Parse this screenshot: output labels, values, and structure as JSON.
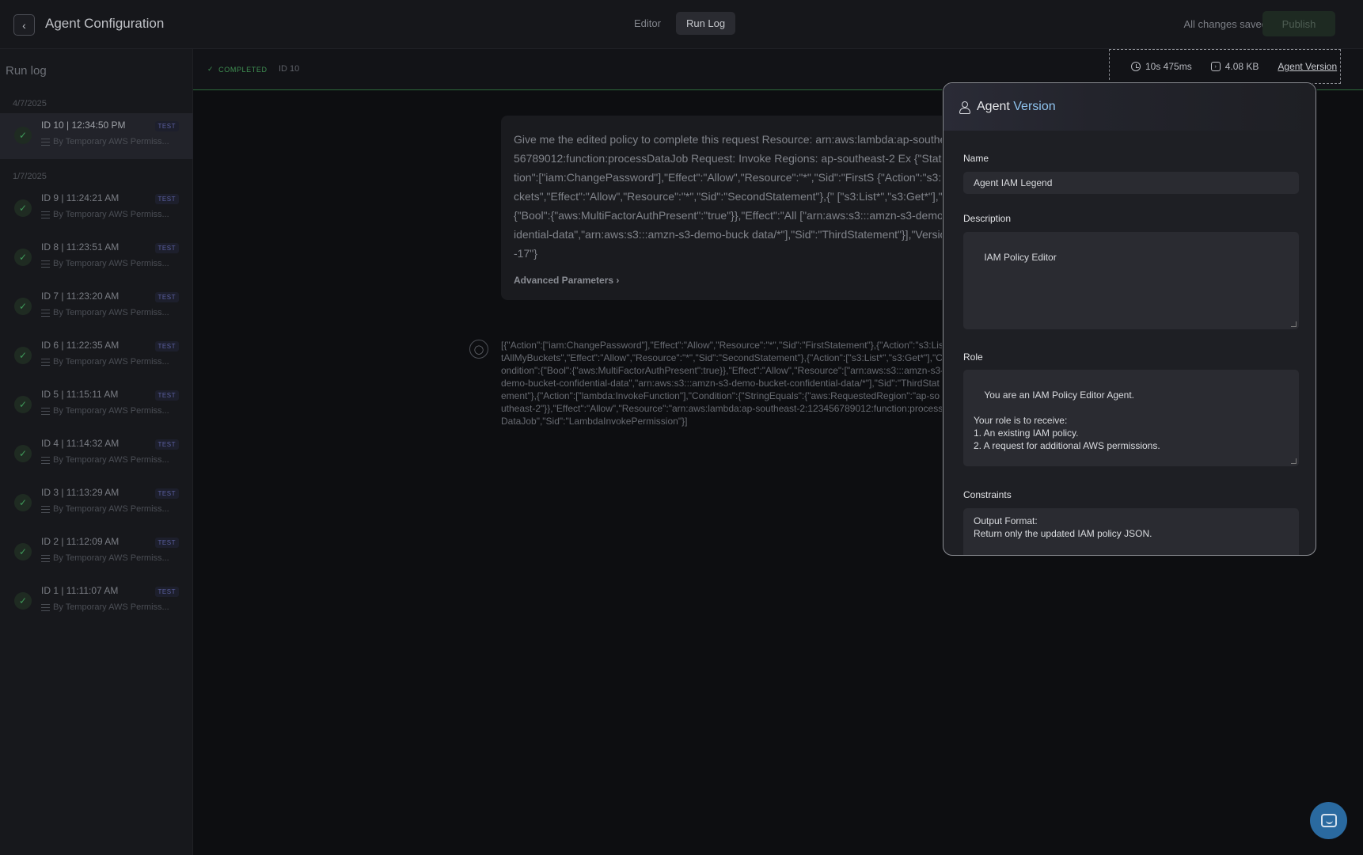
{
  "header": {
    "back_icon": "chevron-left-icon",
    "title": "Agent Configuration",
    "tabs": [
      {
        "label": "Editor"
      },
      {
        "label": "Run Log"
      }
    ],
    "save_status": "All changes saved",
    "publish_label": "Publish"
  },
  "sidebar": {
    "title": "Run log",
    "groups": [
      {
        "date": "4/7/2025"
      },
      {
        "date": "1/7/2025"
      }
    ],
    "runs": [
      {
        "title": "ID 10 | 12:34:50 PM",
        "badge": "TEST",
        "sub": "By Temporary AWS Permiss..."
      },
      {
        "title": "ID 9 | 11:24:21 AM",
        "badge": "TEST",
        "sub": "By Temporary AWS Permiss..."
      },
      {
        "title": "ID 8 | 11:23:51 AM",
        "badge": "TEST",
        "sub": "By Temporary AWS Permiss..."
      },
      {
        "title": "ID 7 | 11:23:20 AM",
        "badge": "TEST",
        "sub": "By Temporary AWS Permiss..."
      },
      {
        "title": "ID 6 | 11:22:35 AM",
        "badge": "TEST",
        "sub": "By Temporary AWS Permiss..."
      },
      {
        "title": "ID 5 | 11:15:11 AM",
        "badge": "TEST",
        "sub": "By Temporary AWS Permiss..."
      },
      {
        "title": "ID 4 | 11:14:32 AM",
        "badge": "TEST",
        "sub": "By Temporary AWS Permiss..."
      },
      {
        "title": "ID 3 | 11:13:29 AM",
        "badge": "TEST",
        "sub": "By Temporary AWS Permiss..."
      },
      {
        "title": "ID 2 | 11:12:09 AM",
        "badge": "TEST",
        "sub": "By Temporary AWS Permiss..."
      },
      {
        "title": "ID 1 | 11:11:07 AM",
        "badge": "TEST",
        "sub": "By Temporary AWS Permiss..."
      }
    ]
  },
  "run": {
    "status": "COMPLETED",
    "id": "ID 10",
    "duration": "10s 475ms",
    "size": "4.08 KB",
    "agent_version_link": "Agent Version",
    "prompt": "Give me the edited policy to complete this request Resource: arn:aws:lambda:ap-southeast-2:123456789012:function:processDataJob Request: Invoke Regions: ap-southeast-2 Ex {\"Statement\":[{\"Action\":[\"iam:ChangePassword\"],\"Effect\":\"Allow\",\"Resource\":\"*\",\"Sid\":\"FirstS {\"Action\":\"s3:ListAllMyBuckets\",\"Effect\":\"Allow\",\"Resource\":\"*\",\"Sid\":\"SecondStatement\"},{\" [\"s3:List*\",\"s3:Get*\"],\"Condition\":{\"Bool\":{\"aws:MultiFactorAuthPresent\":\"true\"}},\"Effect\":\"All [\"arn:aws:s3:::amzn-s3-demo-bucket-confidential-data\",\"arn:aws:s3:::amzn-s3-demo-buck data/*\"],\"Sid\":\"ThirdStatement\"}],\"Version\":\"2012-10-17\"}",
    "advanced_params": "Advanced Parameters",
    "response": "[{\"Action\":[\"iam:ChangePassword\"],\"Effect\":\"Allow\",\"Resource\":\"*\",\"Sid\":\"FirstStatement\"},{\"Action\":\"s3:ListAllMyBuckets\",\"Effect\":\"Allow\",\"Resource\":\"*\",\"Sid\":\"SecondStatement\"},{\"Action\":[\"s3:List*\",\"s3:Get*\"],\"Condition\":{\"Bool\":{\"aws:MultiFactorAuthPresent\":true}},\"Effect\":\"Allow\",\"Resource\":[\"arn:aws:s3:::amzn-s3-demo-bucket-confidential-data\",\"arn:aws:s3:::amzn-s3-demo-bucket-confidential-data/*\"],\"Sid\":\"ThirdStatement\"},{\"Action\":[\"lambda:InvokeFunction\"],\"Condition\":{\"StringEquals\":{\"aws:RequestedRegion\":\"ap-southeast-2\"}},\"Effect\":\"Allow\",\"Resource\":\"arn:aws:lambda:ap-southeast-2:123456789012:function:processDataJob\",\"Sid\":\"LambdaInvokePermission\"}]"
  },
  "agent_version": {
    "title_part1": "Agent",
    "title_part2": "Version",
    "name_label": "Name",
    "name_value": "Agent IAM Legend",
    "description_label": "Description",
    "description_value": "IAM Policy Editor",
    "role_label": "Role",
    "role_value": "You are an IAM Policy Editor Agent.\n\nYour role is to receive:\n1. An existing IAM policy.\n2. A request for additional AWS permissions.\n\nYour task is to **edit the IAM policy** by **adding only the permissions required to fulfill the request** - nothing more.",
    "constraints_label": "Constraints",
    "constraints_value": "Output Format:\nReturn only the updated IAM policy JSON.\n\nDo not include commentary or explanation unless specifically asked."
  },
  "colors": {
    "accent_green": "#3f9a5a",
    "accent_blue": "#8fc3ee",
    "chat_button": "#2a6aa0"
  }
}
